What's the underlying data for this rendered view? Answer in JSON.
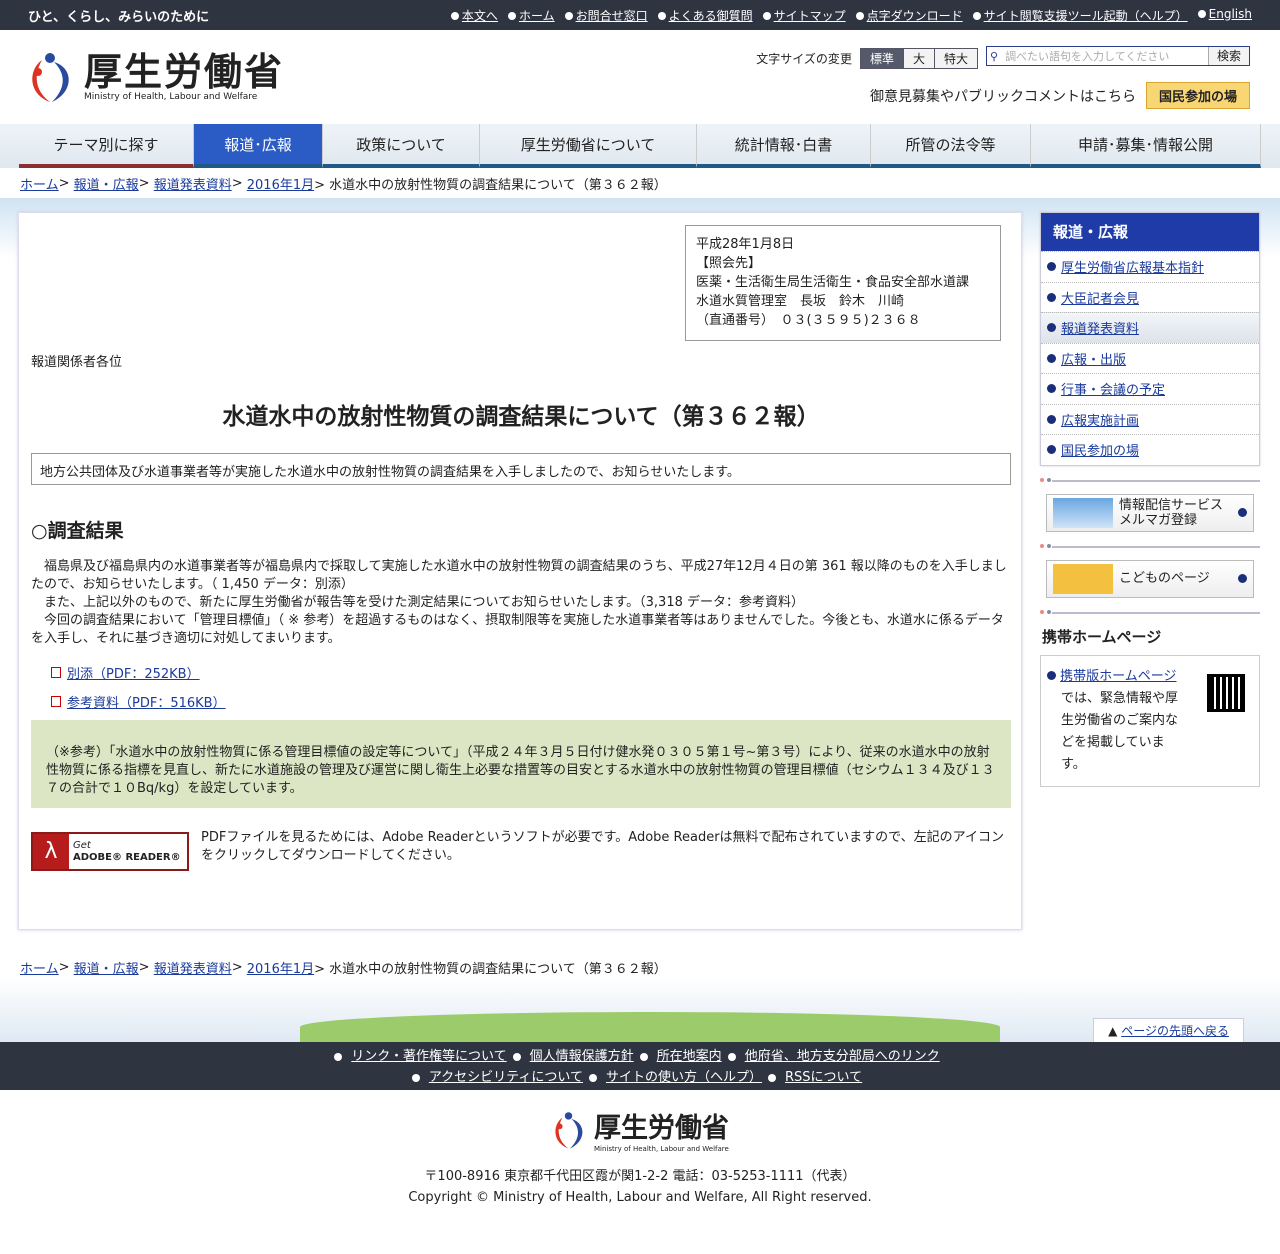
{
  "topbar": {
    "tagline": "ひと、くらし、みらいのために",
    "links": [
      "本文へ",
      "ホーム",
      "お問合せ窓口",
      "よくある御質問",
      "サイトマップ",
      "点字ダウンロード",
      "サイト閲覧支援ツール起動（ヘルプ）",
      "English"
    ]
  },
  "header": {
    "logo_ja": "厚生労働省",
    "logo_en": "Ministry of Health, Labour and Welfare",
    "font_size_label": "文字サイズの変更",
    "font_sizes": [
      "標準",
      "大",
      "特大"
    ],
    "search_placeholder": "調べたい語句を入力してください",
    "search_button": "検索",
    "public_comment_text": "御意見募集やパブリックコメントはこちら",
    "public_button": "国民参加の場"
  },
  "nav": [
    "テーマ別に探す",
    "報道･広報",
    "政策について",
    "厚生労働省について",
    "統計情報･白書",
    "所管の法令等",
    "申請･募集･情報公開"
  ],
  "breadcrumb": [
    "ホーム",
    "報道・広報",
    "報道発表資料",
    "2016年1月"
  ],
  "breadcrumb_current": "> 水道水中の放射性物質の調査結果について（第３６２報）",
  "contact": "平成28年1月8日\n【照会先】\n医薬・生活衛生局生活衛生・食品安全部水道課\n水道水質管理室　長坂　鈴木　川崎\n（直通番号）　０３(３５９５)２３６８",
  "addressee": "報道関係者各位",
  "title": "水道水中の放射性物質の調査結果について（第３６２報）",
  "lead": "地方公共団体及び水道事業者等が実施した水道水中の放射性物質の調査結果を入手しましたので、お知らせいたします。",
  "section": "○調査結果",
  "paragraphs": [
    "福島県及び福島県内の水道事業者等が福島県内で採取して実施した水道水中の放射性物質の調査結果のうち、平成27年12月４日の第 361 報以降のものを入手しましたので、お知らせいたします。（ 1,450 データ：別添）",
    "また、上記以外のもので、新たに厚生労働省が報告等を受けた測定結果についてお知らせいたします。（3,318 データ：参考資料）",
    "今回の調査結果において「管理目標値」（ ※ 参考）を超過するものはなく、摂取制限等を実施した水道事業者等はありませんでした。今後とも、水道水に係るデータを入手し、それに基づき適切に対処してまいります。"
  ],
  "pdfs": [
    "別添（PDF：252KB）",
    "参考資料（PDF：516KB）"
  ],
  "note": "（※参考）「水道水中の放射性物質に係る管理目標値の設定等について」（平成２４年３月５日付け健水発０３０５第１号~第３号）により、従来の水道水中の放射性物質に係る指標を見直し、新たに水道施設の管理及び運営に関し衛生上必要な措置等の目安とする水道水中の放射性物質の管理目標値（セシウム１３４及び１３７の合計で１０Bq/kg）を設定しています。",
  "adobe": {
    "get": "Get",
    "name": "ADOBE® READER®",
    "text": "PDFファイルを見るためには、Adobe Readerというソフトが必要です。Adobe Readerは無料で配布されていますので、左記のアイコンをクリックしてダウンロードしてください。"
  },
  "sidebar": {
    "heading": "報道・広報",
    "items": [
      "厚生労働省広報基本指針",
      "大臣記者会見",
      "報道発表資料",
      "広報・出版",
      "行事・会議の予定",
      "広報実施計画",
      "国民参加の場"
    ],
    "mail_l1": "情報配信サービス",
    "mail_l2": "メルマガ登録",
    "kids": "こどものページ",
    "mobile_heading": "携帯ホームページ",
    "mobile_link": "携帯版ホームページ",
    "mobile_text": "では、緊急情報や厚生労働省のご案内などを掲載しています。"
  },
  "to_top": "ページの先頭へ戻る",
  "footer": {
    "links1": [
      "リンク・著作権等について",
      "個人情報保護方針",
      "所在地案内",
      "他府省、地方支分部局へのリンク"
    ],
    "links2": [
      "アクセシビリティについて",
      "サイトの使い方（ヘルプ）",
      "RSSについて"
    ],
    "address": "〒100-8916 東京都千代田区霞が関1-2-2 電話：03-5253-1111（代表）",
    "copyright": "Copyright © Ministry of Health, Labour and Welfare, All Right reserved."
  },
  "colors": {
    "topbar": "#2f3441",
    "nav_active": "#2b5cc6",
    "note_bg": "#dde6c4",
    "link": "#1a3a9c"
  }
}
